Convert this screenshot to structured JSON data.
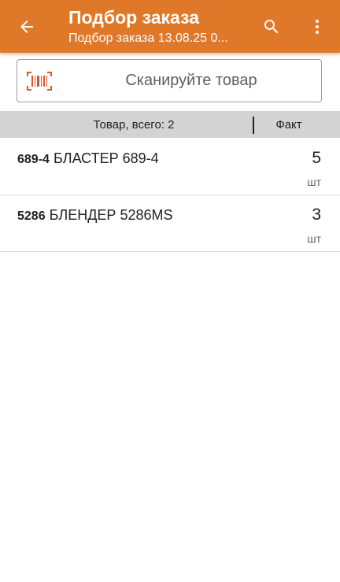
{
  "appbar": {
    "title": "Подбор заказа",
    "subtitle": "Подбор заказа 13.08.25 0...",
    "back_icon": "arrow-left-icon",
    "search_icon": "search-icon",
    "more_icon": "more-vertical-icon",
    "color": "#e0782a"
  },
  "scan": {
    "icon": "barcode-icon",
    "label": "Сканируйте товар",
    "icon_color": "#e0542a"
  },
  "table": {
    "total_label": "Товар, всего: 2",
    "fact_label": "Факт",
    "rows": [
      {
        "code": "689-4",
        "name": "БЛАСТЕР 689-4",
        "qty": "5",
        "unit": "шт"
      },
      {
        "code": "5286",
        "name": "БЛЕНДЕР 5286MS",
        "qty": "3",
        "unit": "шт"
      }
    ]
  }
}
